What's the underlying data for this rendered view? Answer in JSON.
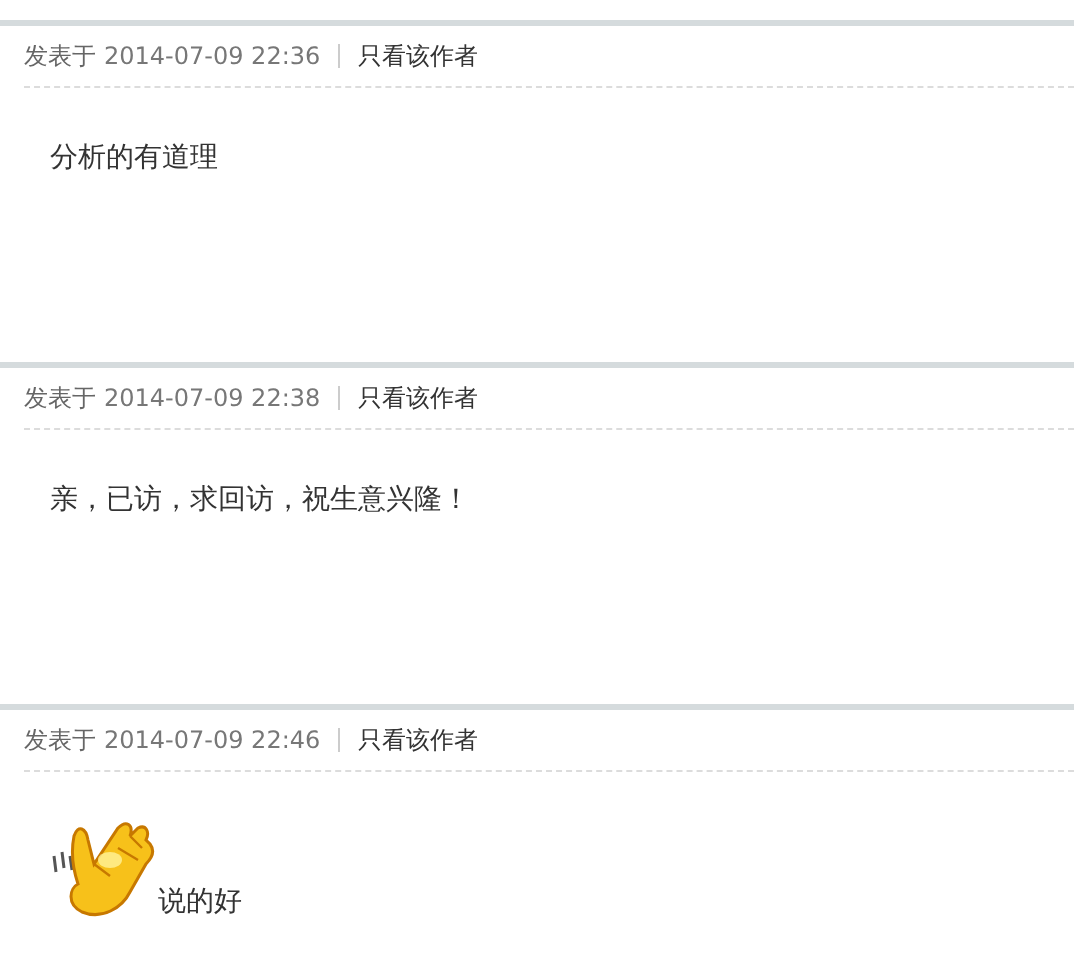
{
  "posts": [
    {
      "posted_label": "发表于",
      "time": "2014-07-09 22:36",
      "author_link": "只看该作者",
      "content": "分析的有道理",
      "emoticon": false
    },
    {
      "posted_label": "发表于",
      "time": "2014-07-09 22:38",
      "author_link": "只看该作者",
      "content": "亲，已访，求回访，祝生意兴隆！",
      "emoticon": false
    },
    {
      "posted_label": "发表于",
      "time": "2014-07-09 22:46",
      "author_link": "只看该作者",
      "content": "说的好",
      "emoticon": true
    }
  ]
}
